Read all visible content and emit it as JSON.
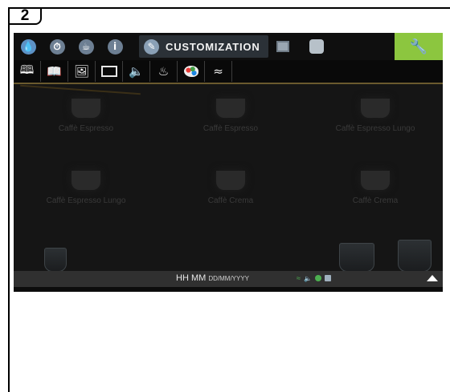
{
  "step": {
    "number": "2"
  },
  "tabs": {
    "active_label": "CUSTOMIZATION",
    "icons": [
      "water-drop-icon",
      "clock-icon",
      "cup-icon",
      "info-icon",
      "pencil-icon",
      "display-icon",
      "user-icon",
      "wrench-icon"
    ]
  },
  "toolbar": {
    "icons": [
      "book-icon",
      "book-open-icon",
      "image-icon",
      "frame-icon",
      "speaker-icon",
      "cup-heating-icon",
      "palette-icon",
      "wifi-icon"
    ]
  },
  "beverages": [
    "Caffè Espresso",
    "Caffè Espresso",
    "Caffè Espresso Lungo",
    "Caffè Espresso Lungo",
    "Caffè Crema",
    "Caffè Crema"
  ],
  "status": {
    "time": "HH MM",
    "date": "DD/MM/YYYY"
  },
  "colors": {
    "active_tab_bg": "#2b3137",
    "wrench_button": "#8cc63f",
    "screen_bg": "#151515",
    "status_green": "#4caf50"
  }
}
